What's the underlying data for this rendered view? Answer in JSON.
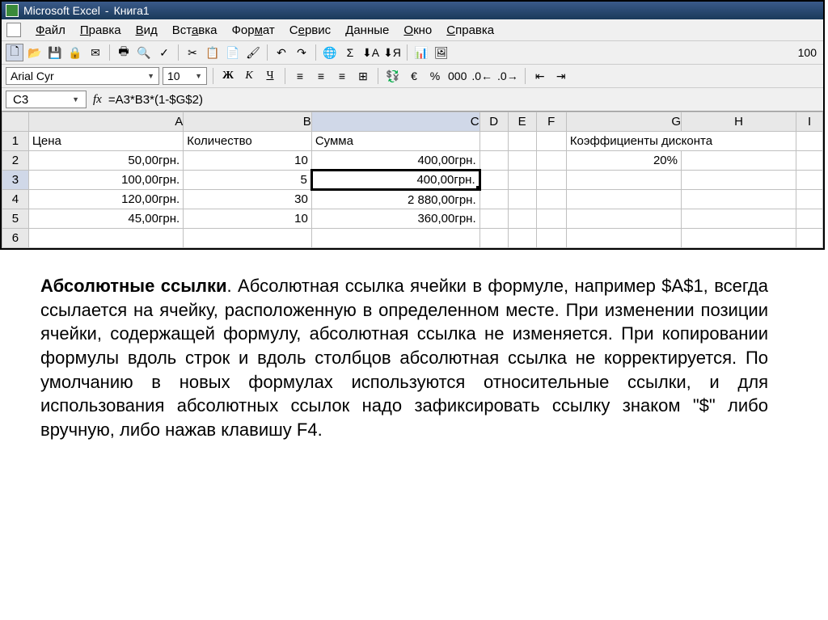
{
  "window": {
    "app": "Microsoft Excel",
    "doc": "Книга1"
  },
  "menu": {
    "file": "Файл",
    "edit": "Правка",
    "view": "Вид",
    "insert": "Вставка",
    "format": "Формат",
    "tools": "Сервис",
    "data": "Данные",
    "window": "Окно",
    "help": "Справка"
  },
  "format_bar": {
    "font": "Arial Cyr",
    "size": "10"
  },
  "toolbar": {
    "zoom": "100"
  },
  "formula_bar": {
    "cell_ref": "C3",
    "fx": "fx",
    "formula": "=A3*B3*(1-$G$2)"
  },
  "columns": [
    "A",
    "B",
    "C",
    "D",
    "E",
    "F",
    "G",
    "H",
    "I"
  ],
  "rows": [
    "1",
    "2",
    "3",
    "4",
    "5",
    "6"
  ],
  "cells": {
    "r1": {
      "A": "Цена",
      "B": "Количество",
      "C": "Сумма",
      "G": "Коэффициенты дисконта"
    },
    "r2": {
      "A": "50,00грн.",
      "B": "10",
      "C": "400,00грн.",
      "G": "20%"
    },
    "r3": {
      "A": "100,00грн.",
      "B": "5",
      "C": "400,00грн."
    },
    "r4": {
      "A": "120,00грн.",
      "B": "30",
      "C": "2 880,00грн."
    },
    "r5": {
      "A": "45,00грн.",
      "B": "10",
      "C": "360,00грн."
    }
  },
  "article": {
    "title": "Абсолютные ссылки",
    "body": ". Абсолютная ссылка ячейки в формуле, например $A$1, всегда ссылается на ячейку, расположенную в определенном месте. При изменении позиции ячейки, содержащей формулу, абсолютная ссылка не изменяется. При копировании формулы вдоль строк и вдоль столбцов абсолютная ссылка не корректируется. По умолчанию в новых формулах используются относительные ссылки, и для использования абсолютных ссылок надо зафиксировать ссылку знаком \"$\" либо вручную, либо нажав клавишу F4."
  }
}
